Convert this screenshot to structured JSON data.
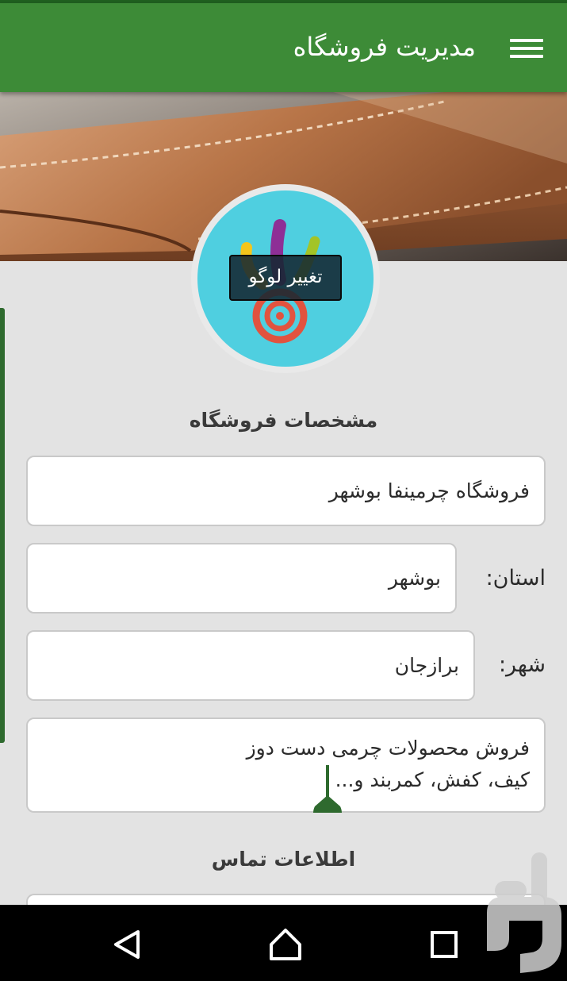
{
  "app": {
    "title": "مدیریت فروشگاه",
    "menu_icon": "hamburger-menu-icon",
    "accent_color": "#3d8b37"
  },
  "logo": {
    "change_label": "تغییر لوگو",
    "background_color": "#4fcfe0"
  },
  "store_info": {
    "section_title": "مشخصات فروشگاه",
    "store_name": "فروشگاه چرمینفا بوشهر",
    "province_label": "استان:",
    "province_value": "بوشهر",
    "city_label": "شهر:",
    "city_value": "برازجان",
    "description_line1": "فروش محصولات چرمی دست دوز",
    "description_line2": "کیف، کفش، کمربند و..."
  },
  "contact": {
    "section_title": "اطلاعات تماس"
  },
  "navbar": {
    "back_icon": "back-triangle-icon",
    "home_icon": "home-icon",
    "recents_icon": "recents-square-icon"
  }
}
